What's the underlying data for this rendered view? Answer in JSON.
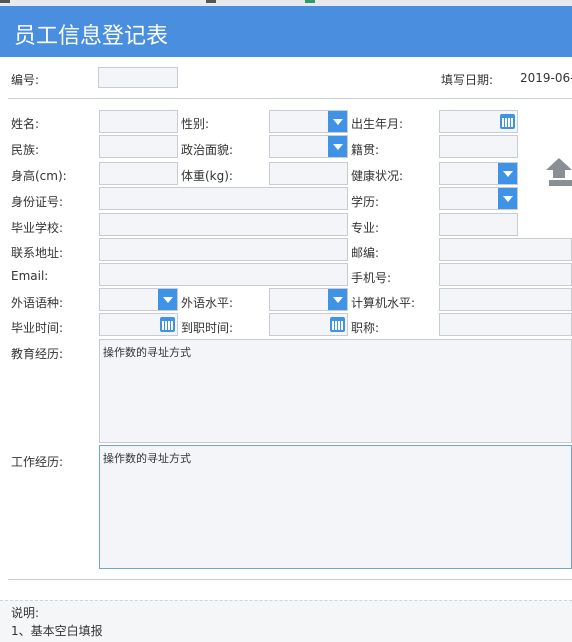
{
  "header": {
    "title": "员工信息登记表"
  },
  "top": {
    "number_label": "编号:",
    "fill_date_label": "填写日期:",
    "fill_date_value": "2019-06-"
  },
  "labels": {
    "name": "姓名:",
    "gender": "性别:",
    "birth": "出生年月:",
    "ethnicity": "民族:",
    "politics": "政治面貌:",
    "native": "籍贯:",
    "height": "身高(cm):",
    "weight": "体重(kg):",
    "health": "健康状况:",
    "idcard": "身份证号:",
    "education": "学历:",
    "school": "毕业学校:",
    "major": "专业:",
    "address": "联系地址:",
    "postcode": "邮编:",
    "email": "Email:",
    "mobile": "手机号:",
    "language": "外语语种:",
    "lang_level": "外语水平:",
    "computer_level": "计算机水平:",
    "grad_time": "毕业时间:",
    "join_time": "到职时间:",
    "title_rank": "职称:",
    "edu_history": "教育经历:",
    "work_history": "工作经历:"
  },
  "textareas": {
    "edu_text": "操作数的寻址方式",
    "work_text": "操作数的寻址方式"
  },
  "notes": {
    "heading": "说明:",
    "line1": "1、基本空白填报"
  },
  "colors": {
    "header": "#4a8ee0",
    "accent": "#3f93e6",
    "field_bg": "#f3f5f8"
  }
}
